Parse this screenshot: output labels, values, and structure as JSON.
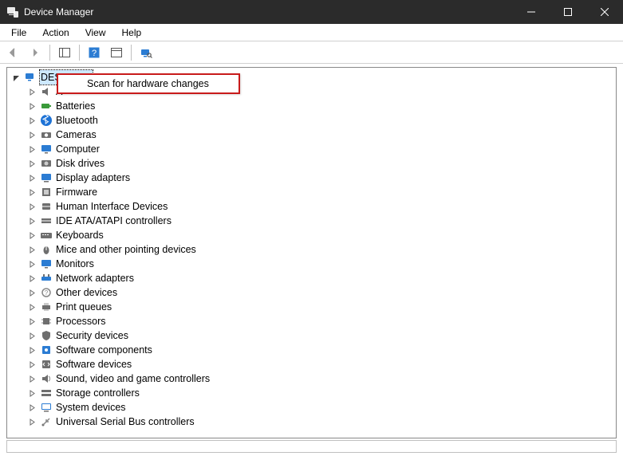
{
  "window": {
    "title": "Device Manager"
  },
  "menus": {
    "file": "File",
    "action": "Action",
    "view": "View",
    "help": "Help"
  },
  "toolbar_buttons": {
    "back": "back",
    "forward": "forward",
    "show_hide": "show-hide-console-tree",
    "help": "help",
    "properties": "properties",
    "scan": "scan-for-hardware-changes"
  },
  "tree": {
    "root": {
      "label": "DESKTOP-",
      "icon": "computer"
    },
    "nodes": [
      {
        "label": "A",
        "icon": "audio"
      },
      {
        "label": "Batteries",
        "icon": "battery"
      },
      {
        "label": "Bluetooth",
        "icon": "bluetooth"
      },
      {
        "label": "Cameras",
        "icon": "camera"
      },
      {
        "label": "Computer",
        "icon": "monitor"
      },
      {
        "label": "Disk drives",
        "icon": "disk"
      },
      {
        "label": "Display adapters",
        "icon": "display"
      },
      {
        "label": "Firmware",
        "icon": "firmware"
      },
      {
        "label": "Human Interface Devices",
        "icon": "hid"
      },
      {
        "label": "IDE ATA/ATAPI controllers",
        "icon": "ide"
      },
      {
        "label": "Keyboards",
        "icon": "keyboard"
      },
      {
        "label": "Mice and other pointing devices",
        "icon": "mouse"
      },
      {
        "label": "Monitors",
        "icon": "monitor"
      },
      {
        "label": "Network adapters",
        "icon": "network"
      },
      {
        "label": "Other devices",
        "icon": "other"
      },
      {
        "label": "Print queues",
        "icon": "printer"
      },
      {
        "label": "Processors",
        "icon": "cpu"
      },
      {
        "label": "Security devices",
        "icon": "security"
      },
      {
        "label": "Software components",
        "icon": "swcomp"
      },
      {
        "label": "Software devices",
        "icon": "swdev"
      },
      {
        "label": "Sound, video and game controllers",
        "icon": "sound"
      },
      {
        "label": "Storage controllers",
        "icon": "storage"
      },
      {
        "label": "System devices",
        "icon": "system"
      },
      {
        "label": "Universal Serial Bus controllers",
        "icon": "usb"
      }
    ]
  },
  "context_menu": {
    "items": [
      {
        "label": "Scan for hardware changes"
      }
    ]
  }
}
